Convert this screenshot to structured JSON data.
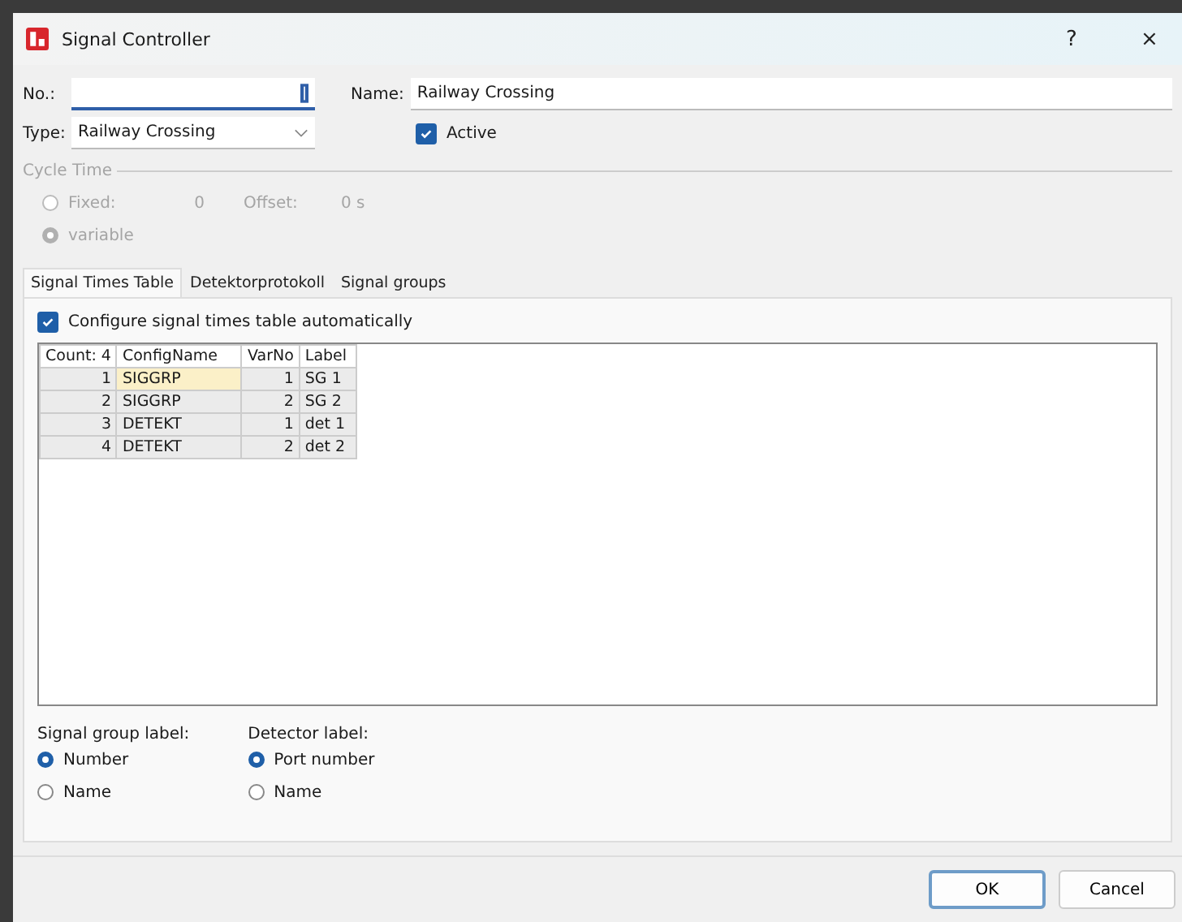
{
  "window": {
    "title": "Signal Controller",
    "help": "?",
    "close": "×"
  },
  "fields": {
    "no_label": "No.:",
    "name_label": "Name:",
    "name_value": "Railway Crossing",
    "type_label": "Type:",
    "type_value": "Railway Crossing",
    "active": {
      "label": "Active",
      "checked": true
    }
  },
  "cycle_time": {
    "title": "Cycle Time",
    "disabled": true,
    "options": [
      {
        "label": "Fixed:",
        "selected": false
      },
      {
        "label": "variable",
        "selected": true
      }
    ],
    "fixed_value": "0",
    "offset_label": "Offset:",
    "offset_value": "0 s"
  },
  "tabs": [
    {
      "label": "Signal Times Table",
      "selected": true
    },
    {
      "label": "Detektorprotokoll",
      "selected": false
    },
    {
      "label": "Signal groups",
      "selected": false
    }
  ],
  "auto_config": {
    "label": "Configure signal times table automatically",
    "checked": true
  },
  "table": {
    "columns": [
      "Count: 4",
      "ConfigName",
      "VarNo",
      "Label"
    ],
    "rows": [
      {
        "cells": [
          "1",
          "SIGGRP",
          "1",
          "SG 1"
        ],
        "selected": true
      },
      {
        "cells": [
          "2",
          "SIGGRP",
          "2",
          "SG 2"
        ],
        "selected": false
      },
      {
        "cells": [
          "3",
          "DETEKT",
          "1",
          "det 1"
        ],
        "selected": false
      },
      {
        "cells": [
          "4",
          "DETEKT",
          "2",
          "det 2"
        ],
        "selected": false
      }
    ]
  },
  "label_groups": [
    {
      "title": "Signal group label:",
      "options": [
        {
          "label": "Number",
          "selected": true
        },
        {
          "label": "Name",
          "selected": false
        }
      ]
    },
    {
      "title": "Detector label:",
      "options": [
        {
          "label": "Port number",
          "selected": true
        },
        {
          "label": "Name",
          "selected": false
        }
      ]
    }
  ],
  "buttons": [
    {
      "label": "OK",
      "default": true
    },
    {
      "label": "Cancel",
      "default": false
    }
  ]
}
